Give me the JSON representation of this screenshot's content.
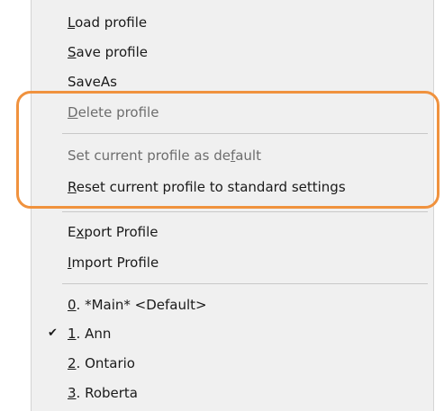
{
  "menu": {
    "items": [
      {
        "pre": "",
        "acc": "L",
        "post": "oad profile"
      },
      {
        "pre": "",
        "acc": "S",
        "post": "ave profile"
      },
      {
        "pre": "SaveAs",
        "acc": "",
        "post": ""
      },
      {
        "pre": "",
        "acc": "D",
        "post": "elete profile"
      },
      {
        "pre": "Set current profile as de",
        "acc": "f",
        "post": "ault"
      },
      {
        "pre": "",
        "acc": "R",
        "post": "eset current profile to standard settings"
      },
      {
        "pre": "E",
        "acc": "x",
        "post": "port Profile"
      },
      {
        "pre": "",
        "acc": "I",
        "post": "mport Profile"
      },
      {
        "pre": "",
        "acc": "0",
        "post": ". *Main* <Default>"
      },
      {
        "pre": "",
        "acc": "1",
        "post": ". Ann"
      },
      {
        "pre": "",
        "acc": "2",
        "post": ". Ontario"
      },
      {
        "pre": "",
        "acc": "3",
        "post": ". Roberta"
      }
    ],
    "checked_glyph": "✔"
  },
  "annotation": {
    "highlight_color": "#f0923e"
  }
}
